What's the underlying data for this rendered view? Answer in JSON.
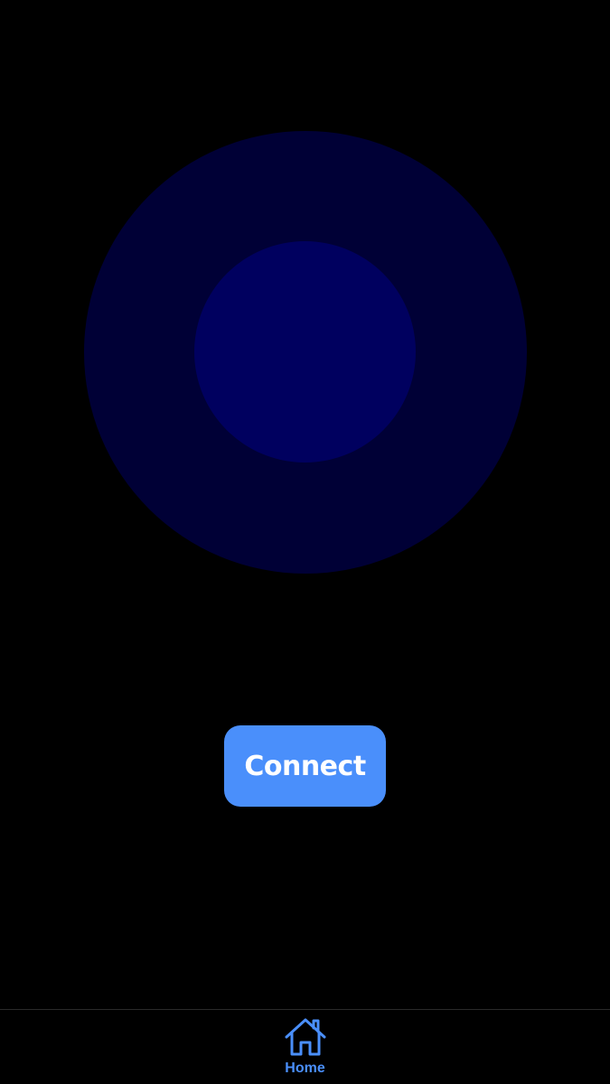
{
  "main": {
    "connect_label": "Connect"
  },
  "tab_bar": {
    "tabs": [
      {
        "label": "Home",
        "icon": "home-icon",
        "active": true
      }
    ]
  },
  "colors": {
    "background": "#000000",
    "orb_outer": "#000036",
    "orb_inner": "#00005f",
    "accent": "#4a8ffb"
  }
}
